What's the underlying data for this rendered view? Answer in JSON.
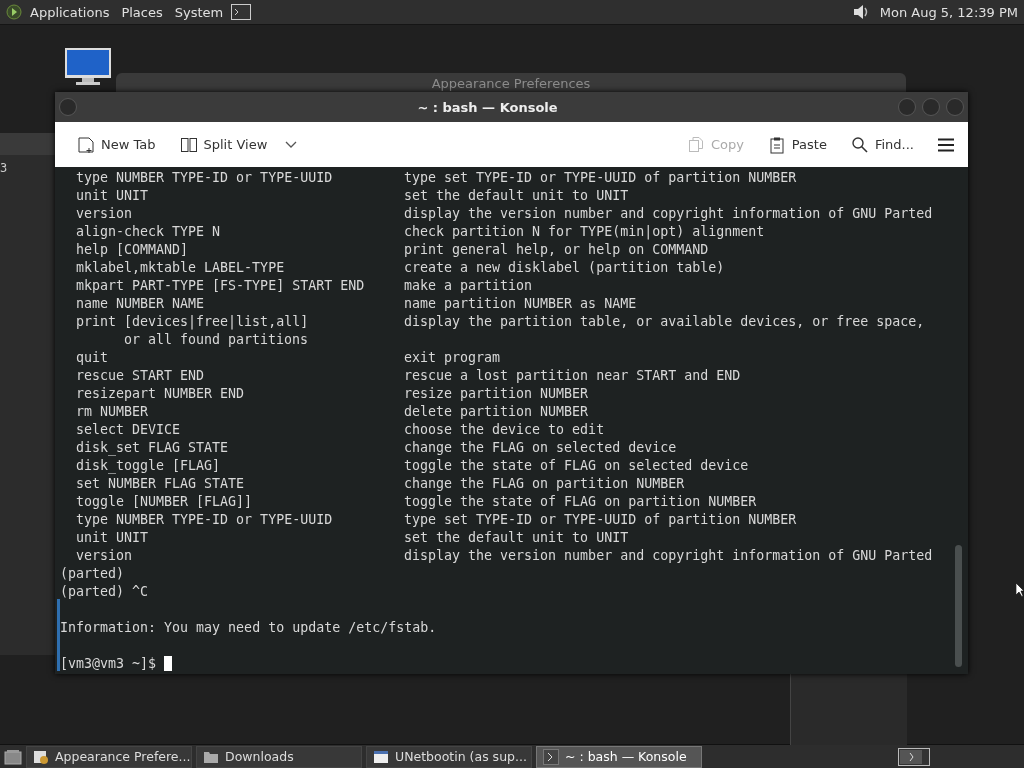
{
  "top_panel": {
    "menus": [
      "Applications",
      "Places",
      "System"
    ],
    "clock": "Mon Aug 5, 12:39 PM"
  },
  "background_window": {
    "title": "Appearance Preferences",
    "side_text": "3"
  },
  "window": {
    "title": "~ : bash — Konsole"
  },
  "toolbar": [
    {
      "kind": "newtab",
      "label": "New Tab",
      "disabled": false
    },
    {
      "kind": "split",
      "label": "Split View",
      "disabled": false
    },
    {
      "kind": "copy",
      "label": "Copy",
      "disabled": true
    },
    {
      "kind": "paste",
      "label": "Paste",
      "disabled": false
    },
    {
      "kind": "find",
      "label": "Find...",
      "disabled": false
    }
  ],
  "terminal": {
    "lines": [
      {
        "kind": "help",
        "command": "type NUMBER TYPE-ID or TYPE-UUID",
        "description": "type set TYPE-ID or TYPE-UUID of partition NUMBER"
      },
      {
        "kind": "help",
        "command": "unit UNIT",
        "description": "set the default unit to UNIT"
      },
      {
        "kind": "help",
        "command": "version",
        "description": "display the version number and copyright information of GNU Parted"
      },
      {
        "kind": "help",
        "command": "align-check TYPE N",
        "description": "check partition N for TYPE(min|opt) alignment"
      },
      {
        "kind": "help",
        "command": "help [COMMAND]",
        "description": "print general help, or help on COMMAND"
      },
      {
        "kind": "help",
        "command": "mklabel,mktable LABEL-TYPE",
        "description": "create a new disklabel (partition table)"
      },
      {
        "kind": "help",
        "command": "mkpart PART-TYPE [FS-TYPE] START END",
        "description": "make a partition"
      },
      {
        "kind": "help",
        "command": "name NUMBER NAME",
        "description": "name partition NUMBER as NAME"
      },
      {
        "kind": "help",
        "command": "print [devices|free|list,all]",
        "description": "display the partition table, or available devices, or free space,"
      },
      {
        "kind": "continuation",
        "text": "or all found partitions"
      },
      {
        "kind": "help",
        "command": "quit",
        "description": "exit program"
      },
      {
        "kind": "help",
        "command": "rescue START END",
        "description": "rescue a lost partition near START and END"
      },
      {
        "kind": "help",
        "command": "resizepart NUMBER END",
        "description": "resize partition NUMBER"
      },
      {
        "kind": "help",
        "command": "rm NUMBER",
        "description": "delete partition NUMBER"
      },
      {
        "kind": "help",
        "command": "select DEVICE",
        "description": "choose the device to edit"
      },
      {
        "kind": "help",
        "command": "disk_set FLAG STATE",
        "description": "change the FLAG on selected device"
      },
      {
        "kind": "help",
        "command": "disk_toggle [FLAG]",
        "description": "toggle the state of FLAG on selected device"
      },
      {
        "kind": "help",
        "command": "set NUMBER FLAG STATE",
        "description": "change the FLAG on partition NUMBER"
      },
      {
        "kind": "help",
        "command": "toggle [NUMBER [FLAG]]",
        "description": "toggle the state of FLAG on partition NUMBER"
      },
      {
        "kind": "help",
        "command": "type NUMBER TYPE-ID or TYPE-UUID",
        "description": "type set TYPE-ID or TYPE-UUID of partition NUMBER"
      },
      {
        "kind": "help",
        "command": "unit UNIT",
        "description": "set the default unit to UNIT"
      },
      {
        "kind": "help",
        "command": "version",
        "description": "display the version number and copyright information of GNU Parted"
      },
      {
        "kind": "text",
        "text": "(parted)"
      },
      {
        "kind": "text",
        "text": "(parted) ^C"
      },
      {
        "kind": "blank"
      },
      {
        "kind": "text",
        "text": "Information: You may need to update /etc/fstab."
      },
      {
        "kind": "blank"
      },
      {
        "kind": "prompt",
        "text": "[vm3@vm3 ~]$"
      }
    ]
  },
  "taskbar": [
    {
      "kind": "prefs",
      "label": "Appearance Prefere...",
      "selected": false
    },
    {
      "kind": "folder",
      "label": "Downloads",
      "selected": false
    },
    {
      "kind": "app",
      "label": "UNetbootin (as sup...",
      "selected": false
    },
    {
      "kind": "terminal",
      "label": "~ : bash — Konsole",
      "selected": true
    }
  ]
}
